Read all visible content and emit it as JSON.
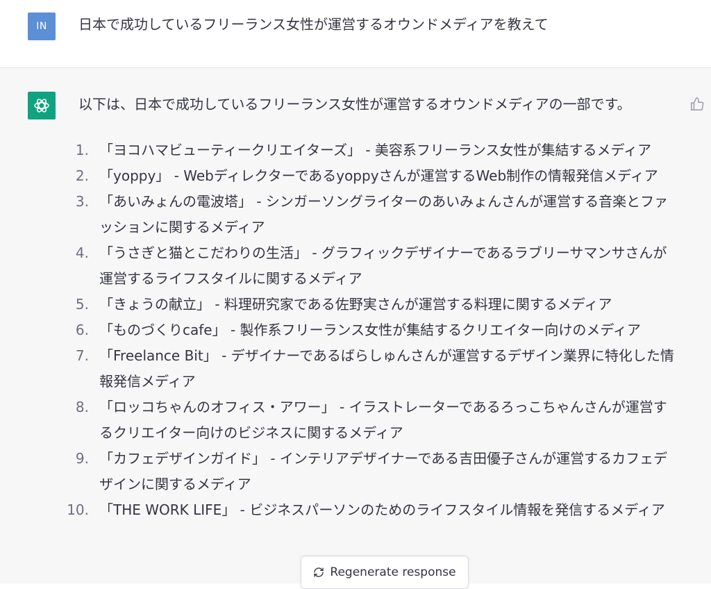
{
  "user": {
    "avatar_initials": "IN",
    "message": "日本で成功しているフリーランス女性が運営するオウンドメディアを教えて"
  },
  "assistant": {
    "intro": "以下は、日本で成功しているフリーランス女性が運営するオウンドメディアの一部です。",
    "items": [
      {
        "num": "1.",
        "text": "「ヨコハマビューティークリエイターズ」 - 美容系フリーランス女性が集結するメディア"
      },
      {
        "num": "2.",
        "text": "「yoppy」 - Webディレクターであるyoppyさんが運営するWeb制作の情報発信メディア"
      },
      {
        "num": "3.",
        "text": "「あいみょんの電波塔」 - シンガーソングライターのあいみょんさんが運営する音楽とファッションに関するメディア"
      },
      {
        "num": "4.",
        "text": "「うさぎと猫とこだわりの生活」 - グラフィックデザイナーであるラブリーサマンサさんが運営するライフスタイルに関するメディア"
      },
      {
        "num": "5.",
        "text": "「きょうの献立」 - 料理研究家である佐野実さんが運営する料理に関するメディア"
      },
      {
        "num": "6.",
        "text": "「ものづくりcafe」 - 製作系フリーランス女性が集結するクリエイター向けのメディア"
      },
      {
        "num": "7.",
        "text": "「Freelance Bit」 - デザイナーであるばらしゅんさんが運営するデザイン業界に特化した情報発信メディア"
      },
      {
        "num": "8.",
        "text": "「ロッコちゃんのオフィス・アワー」 - イラストレーターであるろっこちゃんさんが運営するクリエイター向けのビジネスに関するメディア"
      },
      {
        "num": "9.",
        "text": "「カフェデザインガイド」 - インテリアデザイナーである吉田優子さんが運営するカフェデザインに関するメディア"
      },
      {
        "num": "10.",
        "text": "「THE WORK LIFE」 - ビジネスパーソンのためのライフスタイル情報を発信するメディア"
      }
    ]
  },
  "regenerate": {
    "label": "Regenerate response"
  },
  "icons": {
    "bot_logo": "openai-logo-icon",
    "thumb": "thumbs-up-icon",
    "regen": "refresh-icon"
  },
  "colors": {
    "user_avatar": "#5b8fd6",
    "bot_avatar": "#10a37f",
    "assistant_bg": "#f7f7f8"
  }
}
